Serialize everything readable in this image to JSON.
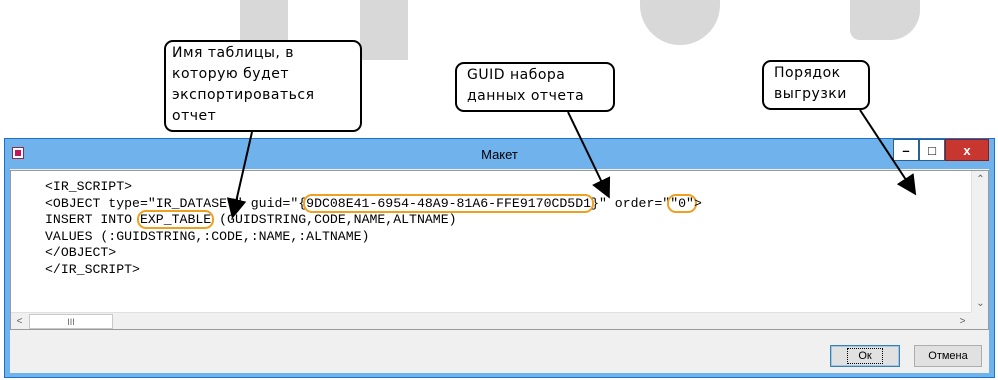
{
  "callouts": {
    "table_name": "Имя таблицы, в\nкоторую будет\nэкспортироваться\nотчет",
    "guid": "GUID набора\nданных отчета",
    "order": "Порядок\nвыгрузки"
  },
  "window": {
    "title": "Макет",
    "minimize": "–",
    "maximize": "□",
    "close": "x"
  },
  "editor": {
    "lines": {
      "l1": "<IR_SCRIPT>",
      "l2_pre": "<OBJECT type=\"IR_DATASET\" guid=\"{",
      "l2_guid": "9DC08E41-6954-48A9-81A6-FFE9170CD5D1",
      "l2_mid": "}\" order=\"",
      "l2_order": "\"0\"",
      "l2_post": ">",
      "l3_pre": "INSERT INTO ",
      "l3_table": "EXP_TABLE",
      "l3_post": " (GUIDSTRING,CODE,NAME,ALTNAME)",
      "l4": "VALUES (:GUIDSTRING,:CODE,:NAME,:ALTNAME)",
      "l5": "</OBJECT>",
      "l6": "</IR_SCRIPT>"
    },
    "scroll_thumb_glyph": "III"
  },
  "buttons": {
    "ok": "Ок",
    "cancel": "Отмена"
  },
  "colors": {
    "titlebar": "#6fb2ec",
    "highlight": "#f0a020",
    "close": "#c7372f"
  }
}
